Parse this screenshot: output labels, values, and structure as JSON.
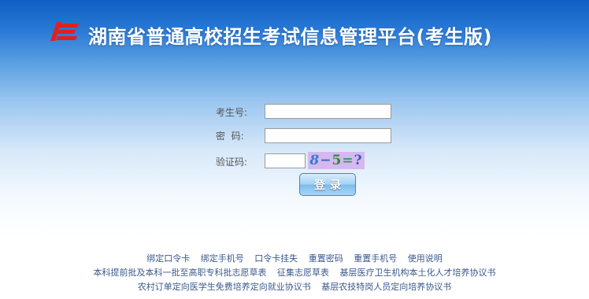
{
  "header": {
    "title": "湖南省普通高校招生考试信息管理平台(考生版)"
  },
  "form": {
    "candidate_no_label": "考生号:",
    "password_label": "密  码:",
    "captcha_label": "验证码:",
    "candidate_no_value": "",
    "password_value": "",
    "captcha_value": "",
    "captcha": {
      "d1": "8",
      "op": "−",
      "d2": "5",
      "eq": "=",
      "q": "?"
    },
    "login_label": "登录"
  },
  "links": {
    "row1": [
      "绑定口令卡",
      "绑定手机号",
      "口令卡挂失",
      "重置密码",
      "重置手机号",
      "使用说明"
    ],
    "row2": [
      "本科提前批及本科一批至高职专科批志愿草表",
      "征集志愿草表",
      "基层医疗卫生机构本土化人才培养协议书"
    ],
    "row3": [
      "农村订单定向医学生免费培养定向就业协议书",
      "基层农技特岗人员定向培养协议书"
    ]
  },
  "colors": {
    "header_blue": "#0f5fc4",
    "logo_red": "#e02020",
    "link_text": "#3a5a8c",
    "captcha_bg": "#d6b8ee"
  },
  "icons": {
    "logo": "red-stylized-logo-icon"
  }
}
